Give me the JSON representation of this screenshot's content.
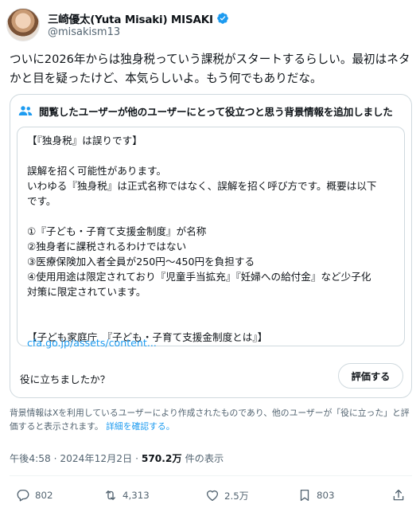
{
  "author": {
    "display_name": "三崎優太(Yuta Misaki) MISAKI",
    "handle": "@misakism13"
  },
  "tweet": {
    "text": "ついに2026年からは独身税っていう課税がスタートするらしい。最初はネタかと目を疑ったけど、本気らしいよ。もう何でもありだな。"
  },
  "community_note": {
    "header": "閲覧したユーザーが他のユーザーにとって役立つと思う背景情報を追加しました",
    "lines": [
      "【『独身税』は誤りです】",
      "",
      "誤解を招く可能性があります。",
      "いわゆる『独身税』は正式名称ではなく、誤解を招く呼び方です。概要は以下",
      "です。",
      "",
      "①『子ども・子育て支援金制度』が名称",
      "②独身者に課税されるわけではない",
      "③医療保険加入者全員が250円〜450円を負担する",
      "④使用用途は限定されており『児童手当拡充』『妊婦への給付金』など少子化",
      "対策に限定されています。",
      "",
      "",
      "【子ども家庭庁　『子ども・子育て支援金制度とは』】"
    ],
    "link": "cfa.go.jp/assets/content...",
    "helpful_question": "役に立ちましたか？",
    "rate_button": "評価する"
  },
  "disclaimer": {
    "text": "背景情報はXを利用しているユーザーにより作成されたものであり、他のユーザーが「役に立った」と評価すると表示されます。",
    "link": "詳細を確認する。"
  },
  "meta": {
    "time": "午後4:58 · 2024年12月2日 · ",
    "views": "570.2万",
    "views_suffix": " 件の表示"
  },
  "actions": {
    "replies": "802",
    "retweets": "4,313",
    "likes": "2.5万",
    "bookmarks": "803"
  },
  "colors": {
    "accent": "#1d9bf0",
    "text": "#0f1419",
    "muted": "#536471",
    "border": "#cfd9de"
  }
}
